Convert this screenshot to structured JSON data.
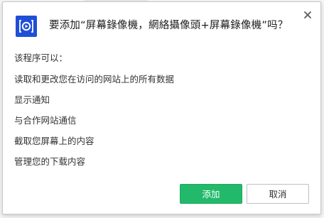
{
  "dialog": {
    "title": "要添加“屏幕錄像機，網絡攝像頭+屏幕錄像機”吗？",
    "close_icon": "close-icon",
    "extension_icon": "screen-recorder-icon",
    "accent_color": "#1f4fd8",
    "permissions_heading": "该程序可以：",
    "permissions": [
      "读取和更改您在访问的网站上的所有数据",
      "显示通知",
      "与合作网站通信",
      "截取您屏幕上的内容",
      "管理您的下载内容"
    ],
    "add_label": "添加",
    "cancel_label": "取消",
    "add_color": "#22b96a"
  }
}
